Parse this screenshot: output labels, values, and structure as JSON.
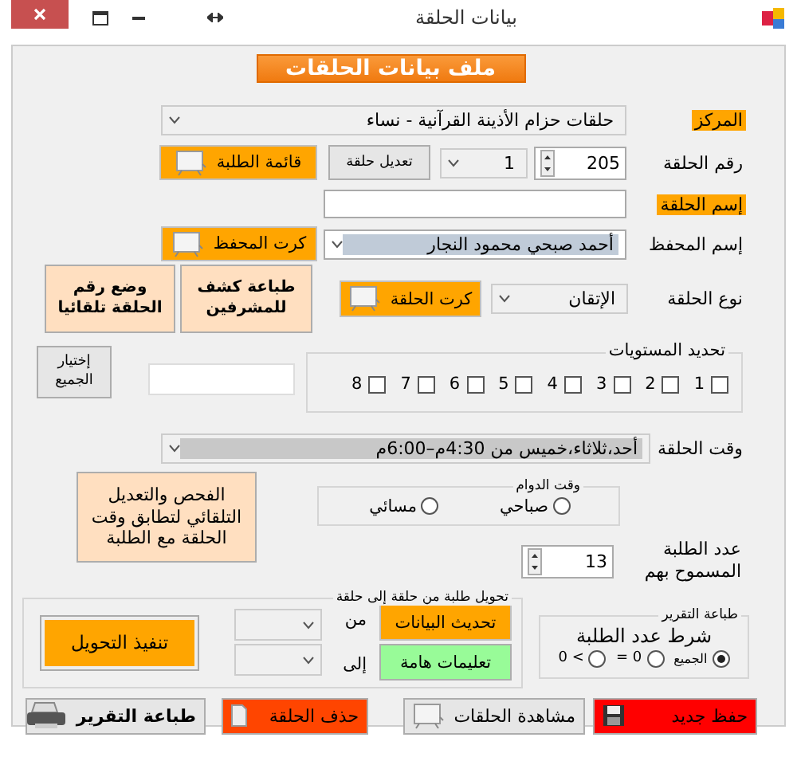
{
  "window": {
    "title": "بيانات الحلقة"
  },
  "header": "ملف بيانات الحلقات",
  "center": {
    "label": "المركز",
    "value": "حلقات حزام الأذينة القرآنية  - نساء"
  },
  "circle_number": {
    "label": "رقم الحلقة",
    "value": "205",
    "sub_value": "1",
    "edit_button": "تعديل حلقة",
    "students_button": "قائمة الطلبة"
  },
  "circle_name": {
    "label": "إسم الحلقة"
  },
  "teacher": {
    "label": "إسم المحفظ",
    "value": "أحمد صبحي محمود النجار",
    "card_button": "كرت المحفظ"
  },
  "circle_type": {
    "label": "نوع الحلقة",
    "value": "الإتقان",
    "card_button": "كرت الحلقة"
  },
  "side_buttons": [
    "طباعة كشف للمشرفين",
    "وضع رقم الحلقة تلقائيا"
  ],
  "levels": {
    "title": "تحديد المستويات",
    "select_all_button": "إختيار الجميع",
    "items": [
      {
        "label": "1",
        "checked": false
      },
      {
        "label": "2",
        "checked": false
      },
      {
        "label": "3",
        "checked": false
      },
      {
        "label": "4",
        "checked": false
      },
      {
        "label": "5",
        "checked": false
      },
      {
        "label": "6",
        "checked": false
      },
      {
        "label": "7",
        "checked": false
      },
      {
        "label": "8",
        "checked": false
      }
    ]
  },
  "schedule": {
    "label": "وقت الحلقة",
    "value": "أحد،ثلاثاء،خميس من 4:30م–6:00م"
  },
  "check_button": "الفحص والتعديل التلقائي لتطابق وقت الحلقة مع الطلبة",
  "shift": {
    "title": "وقت الدوام",
    "options": [
      {
        "label": "صباحي",
        "selected": false
      },
      {
        "label": "مسائي",
        "selected": false
      }
    ]
  },
  "capacity": {
    "label": "عدد الطلبة المسموح بهم",
    "value": "13"
  },
  "transfer": {
    "title": "تحويل طلبة من حلقة إلى حلقة",
    "refresh_button": "تحديث البيانات",
    "help_button": "تعليمات هامة",
    "from_label": "من",
    "to_label": "إلى",
    "execute_button": "تنفيذ التحويل"
  },
  "report": {
    "title": "طباعة التقرير",
    "condition": "شرط عدد الطلبة",
    "options": [
      {
        "label": "الجميع",
        "selected": true
      },
      {
        "label": "= 0",
        "selected": false
      },
      {
        "label": "0 <",
        "selected": false
      }
    ]
  },
  "actions": [
    {
      "kind": "save",
      "label": "حفظ جديد"
    },
    {
      "kind": "view",
      "label": "مشاهدة الحلقات"
    },
    {
      "kind": "delete",
      "label": "حذف الحلقة"
    },
    {
      "kind": "print",
      "label": "طباعة التقرير"
    }
  ]
}
